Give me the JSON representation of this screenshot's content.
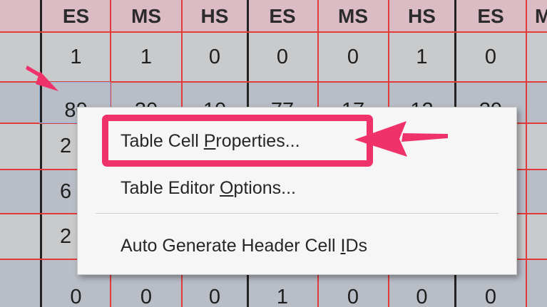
{
  "table": {
    "headers": [
      "ES",
      "MS",
      "HS",
      "ES",
      "MS",
      "HS",
      "ES",
      "M"
    ],
    "rows": [
      [
        "1",
        "1",
        "0",
        "0",
        "0",
        "1",
        "0"
      ],
      [
        "80",
        "30",
        "10",
        "77",
        "17",
        "12",
        "39"
      ],
      [
        "2",
        "",
        "",
        "",
        "",
        "",
        "",
        ""
      ],
      [
        "6",
        "",
        "",
        "",
        "",
        "",
        "",
        ""
      ],
      [
        "2",
        "",
        "",
        "",
        "",
        "",
        "",
        ""
      ],
      [
        "0",
        "0",
        "0",
        "1",
        "0",
        "0",
        "0"
      ]
    ]
  },
  "context_menu": {
    "items": [
      {
        "pre": "Table Cell ",
        "key": "P",
        "post": "roperties..."
      },
      {
        "pre": "Table Editor ",
        "key": "O",
        "post": "ptions..."
      },
      {
        "pre": "Auto Generate Header Cell ",
        "key": "I",
        "post": "Ds"
      }
    ]
  },
  "colors": {
    "header_bg": "#dcbcc4",
    "row_light": "#c9cacb",
    "row_dark": "#b9bdc6",
    "grid": "#e23b3b",
    "highlight": "#f0326a",
    "menu_bg": "#f6f6f6"
  }
}
